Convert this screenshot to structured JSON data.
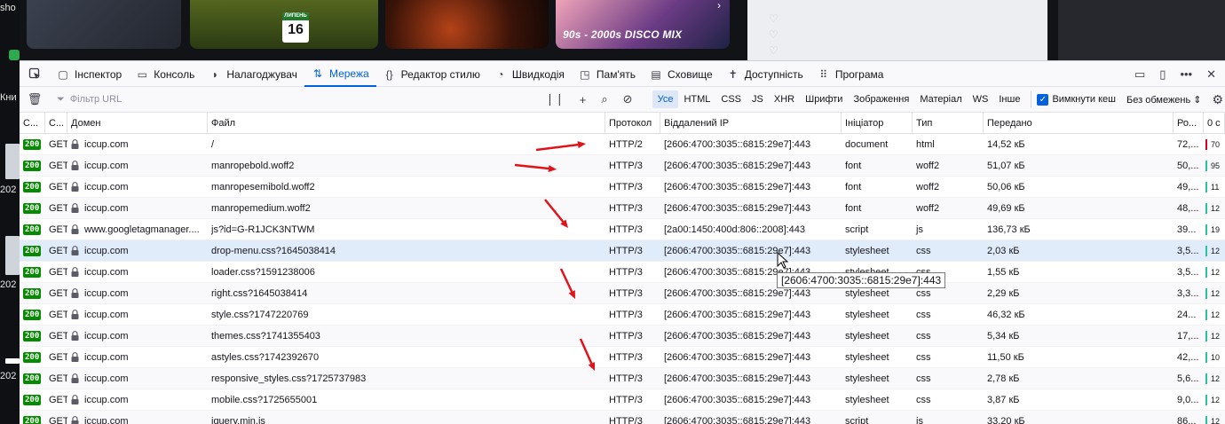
{
  "background": {
    "left_texts": [
      "sho",
      "Кни",
      "202",
      "202",
      "202"
    ],
    "calendar": {
      "month": "ЛИПЕНЬ",
      "day": "16"
    },
    "banner_text": "90s - 2000s DISCO MIX",
    "carousel_arrow": "›"
  },
  "devtools": {
    "tabs": [
      {
        "label": "Інспектор",
        "icon": "inspector-icon"
      },
      {
        "label": "Консоль",
        "icon": "console-icon"
      },
      {
        "label": "Налагоджувач",
        "icon": "debugger-icon"
      },
      {
        "label": "Мережа",
        "icon": "network-icon",
        "active": true
      },
      {
        "label": "Редактор стилю",
        "icon": "style-editor-icon"
      },
      {
        "label": "Швидкодія",
        "icon": "performance-icon"
      },
      {
        "label": "Пам'ять",
        "icon": "memory-icon"
      },
      {
        "label": "Сховище",
        "icon": "storage-icon"
      },
      {
        "label": "Доступність",
        "icon": "accessibility-icon"
      },
      {
        "label": "Програма",
        "icon": "application-icon"
      }
    ],
    "filter_placeholder": "Фільтр URL",
    "filter_types": [
      "Усе",
      "HTML",
      "CSS",
      "JS",
      "XHR",
      "Шрифти",
      "Зображення",
      "Матеріал",
      "WS",
      "Інше"
    ],
    "active_filter": "Усе",
    "disable_cache_label": "Вимкнути кеш",
    "disable_cache_checked": true,
    "throttle_label": "Без обмежень ⇕",
    "columns": [
      "С...",
      "С...",
      "Домен",
      "Файл",
      "Протокол",
      "Віддалений IP",
      "Ініціатор",
      "Тип",
      "Передано",
      "Ро...",
      "0 с"
    ],
    "requests": [
      {
        "status": "200",
        "method": "GET",
        "domain": "iccup.com",
        "file": "/",
        "protocol": "HTTP/2",
        "ip": "[2606:4700:3035::6815:29e7]:443",
        "initiator": "document",
        "type": "html",
        "transferred": "14,52 кБ",
        "size": "72,...",
        "timing": "70",
        "bar_color": "#d70022"
      },
      {
        "status": "200",
        "method": "GET",
        "domain": "iccup.com",
        "file": "manropebold.woff2",
        "protocol": "HTTP/3",
        "ip": "[2606:4700:3035::6815:29e7]:443",
        "initiator": "font",
        "type": "woff2",
        "transferred": "51,07 кБ",
        "size": "50,...",
        "timing": "95",
        "bar_color": "#2ac3a2"
      },
      {
        "status": "200",
        "method": "GET",
        "domain": "iccup.com",
        "file": "manropesemibold.woff2",
        "protocol": "HTTP/3",
        "ip": "[2606:4700:3035::6815:29e7]:443",
        "initiator": "font",
        "type": "woff2",
        "transferred": "50,06 кБ",
        "size": "49,...",
        "timing": "11",
        "bar_color": "#2ac3a2"
      },
      {
        "status": "200",
        "method": "GET",
        "domain": "iccup.com",
        "file": "manropemedium.woff2",
        "protocol": "HTTP/3",
        "ip": "[2606:4700:3035::6815:29e7]:443",
        "initiator": "font",
        "type": "woff2",
        "transferred": "49,69 кБ",
        "size": "48,...",
        "timing": "12",
        "bar_color": "#2ac3a2"
      },
      {
        "status": "200",
        "method": "GET",
        "domain": "www.googletagmanager....",
        "file": "js?id=G-R1JCK3NTWM",
        "protocol": "HTTP/3",
        "ip": "[2a00:1450:400d:806::2008]:443",
        "initiator": "script",
        "type": "js",
        "transferred": "136,73 кБ",
        "size": "39...",
        "timing": "19",
        "bar_color": "#2ac3a2"
      },
      {
        "status": "200",
        "method": "GET",
        "domain": "iccup.com",
        "file": "drop-menu.css?1645038414",
        "protocol": "HTTP/3",
        "ip": "[2606:4700:3035::6815:29e7]:443",
        "initiator": "stylesheet",
        "type": "css",
        "transferred": "2,03 кБ",
        "size": "3,5...",
        "timing": "12",
        "bar_color": "#2ac3a2"
      },
      {
        "status": "200",
        "method": "GET",
        "domain": "iccup.com",
        "file": "loader.css?1591238006",
        "protocol": "HTTP/3",
        "ip": "[2606:4700:3035::6815:29e7]:443",
        "initiator": "stylesheet",
        "type": "css",
        "transferred": "1,55 кБ",
        "size": "3,5...",
        "timing": "12",
        "bar_color": "#2ac3a2"
      },
      {
        "status": "200",
        "method": "GET",
        "domain": "iccup.com",
        "file": "right.css?1645038414",
        "protocol": "HTTP/3",
        "ip": "[2606:4700:3035::6815:29e7]:443",
        "initiator": "stylesheet",
        "type": "css",
        "transferred": "2,29 кБ",
        "size": "3,3...",
        "timing": "12",
        "bar_color": "#2ac3a2"
      },
      {
        "status": "200",
        "method": "GET",
        "domain": "iccup.com",
        "file": "style.css?1747220769",
        "protocol": "HTTP/3",
        "ip": "[2606:4700:3035::6815:29e7]:443",
        "initiator": "stylesheet",
        "type": "css",
        "transferred": "46,32 кБ",
        "size": "24...",
        "timing": "12",
        "bar_color": "#2ac3a2"
      },
      {
        "status": "200",
        "method": "GET",
        "domain": "iccup.com",
        "file": "themes.css?1741355403",
        "protocol": "HTTP/3",
        "ip": "[2606:4700:3035::6815:29e7]:443",
        "initiator": "stylesheet",
        "type": "css",
        "transferred": "5,34 кБ",
        "size": "17,...",
        "timing": "12",
        "bar_color": "#2ac3a2"
      },
      {
        "status": "200",
        "method": "GET",
        "domain": "iccup.com",
        "file": "astyles.css?1742392670",
        "protocol": "HTTP/3",
        "ip": "[2606:4700:3035::6815:29e7]:443",
        "initiator": "stylesheet",
        "type": "css",
        "transferred": "11,50 кБ",
        "size": "42,...",
        "timing": "10",
        "bar_color": "#2ac3a2"
      },
      {
        "status": "200",
        "method": "GET",
        "domain": "iccup.com",
        "file": "responsive_styles.css?1725737983",
        "protocol": "HTTP/3",
        "ip": "[2606:4700:3035::6815:29e7]:443",
        "initiator": "stylesheet",
        "type": "css",
        "transferred": "2,78 кБ",
        "size": "5,6...",
        "timing": "12",
        "bar_color": "#2ac3a2"
      },
      {
        "status": "200",
        "method": "GET",
        "domain": "iccup.com",
        "file": "mobile.css?1725655001",
        "protocol": "HTTP/3",
        "ip": "[2606:4700:3035::6815:29e7]:443",
        "initiator": "stylesheet",
        "type": "css",
        "transferred": "3,87 кБ",
        "size": "9,0...",
        "timing": "12",
        "bar_color": "#2ac3a2"
      },
      {
        "status": "200",
        "method": "GET",
        "domain": "iccup.com",
        "file": "jquery.min.js",
        "protocol": "HTTP/3",
        "ip": "[2606:4700:3035::6815:29e7]:443",
        "initiator": "script",
        "type": "js",
        "transferred": "33,20 кБ",
        "size": "86...",
        "timing": "12",
        "bar_color": "#2ac3a2"
      }
    ],
    "selected_row": 5,
    "tooltip": "[2606:4700:3035::6815:29e7]:443"
  },
  "annotation_color": "#e0121a"
}
